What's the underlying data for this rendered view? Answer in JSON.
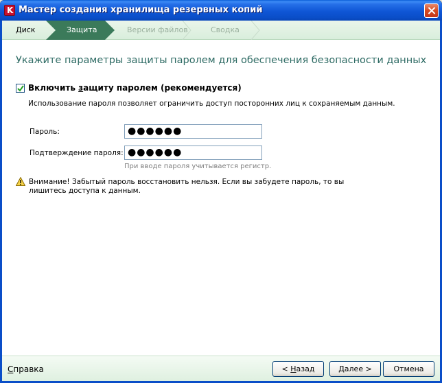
{
  "window": {
    "title": "Мастер создания хранилища резервных копий"
  },
  "steps": [
    {
      "label": "Диск"
    },
    {
      "label": "Защита"
    },
    {
      "label": "Версии файлов"
    },
    {
      "label": "Сводка"
    }
  ],
  "main": {
    "heading": "Укажите параметры защиты паролем для обеспечения безопасности данных",
    "checkbox": {
      "label_before": "Включить ",
      "label_underlined": "з",
      "label_after": "ащиту паролем (рекомендуется)",
      "checked": true
    },
    "description": "Использование пароля позволяет ограничить доступ посторонних лиц к сохраняемым данным.",
    "password_label": "Пароль:",
    "password_value": "●●●●●●",
    "confirm_label": "Подтверждение пароля:",
    "confirm_value": "●●●●●●",
    "hint": "При вводе пароля учитывается регистр.",
    "warning": "Внимание! Забытый пароль восстановить нельзя. Если вы забудете пароль, то вы лишитесь доступа к данным."
  },
  "footer": {
    "help_underlined": "С",
    "help_rest": "правка",
    "back_before": "< ",
    "back_underlined": "Н",
    "back_after": "азад",
    "next_underlined": "Д",
    "next_after": "алее >",
    "cancel_label": "Отмена"
  },
  "colors": {
    "active_step": "#3b7a5a",
    "heading": "#2e6b64",
    "titlebar": "#0f56d6"
  }
}
